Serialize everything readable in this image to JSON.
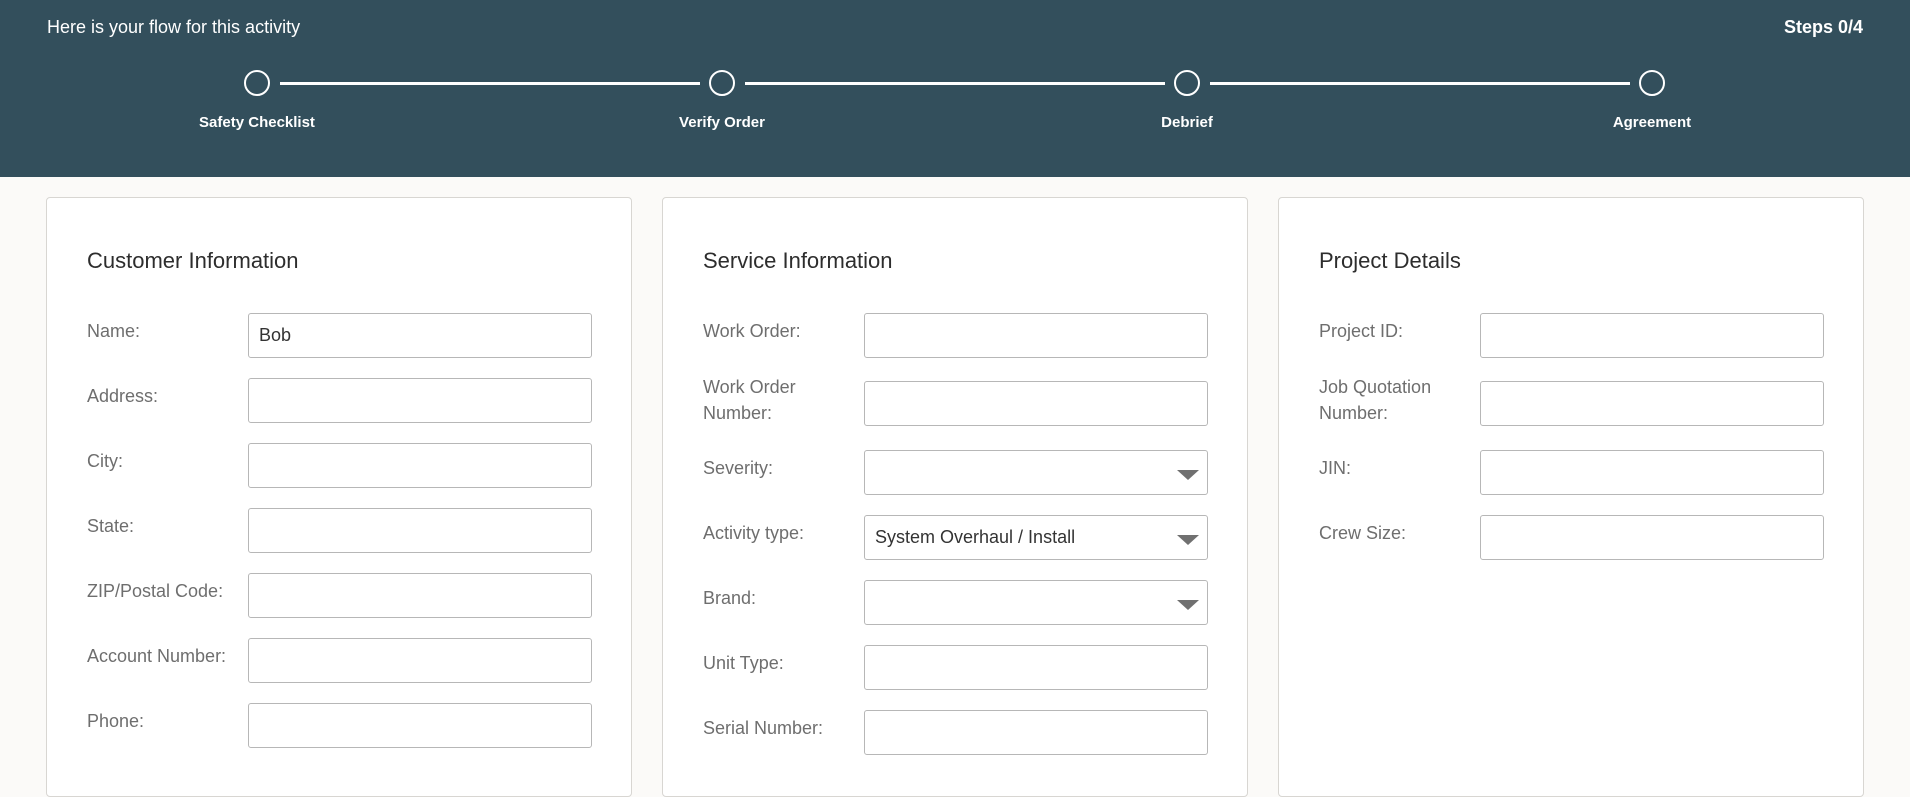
{
  "header": {
    "title": "Here is your flow for this activity",
    "steps_counter": "Steps 0/4",
    "steps": [
      {
        "label": "Safety Checklist"
      },
      {
        "label": "Verify Order"
      },
      {
        "label": "Debrief"
      },
      {
        "label": "Agreement"
      }
    ]
  },
  "customer": {
    "title": "Customer Information",
    "fields": {
      "name": {
        "label": "Name:",
        "value": "Bob"
      },
      "address": {
        "label": "Address:",
        "value": ""
      },
      "city": {
        "label": "City:",
        "value": ""
      },
      "state": {
        "label": "State:",
        "value": ""
      },
      "zip": {
        "label": "ZIP/Postal Code:",
        "value": ""
      },
      "account": {
        "label": "Account Number:",
        "value": ""
      },
      "phone": {
        "label": "Phone:",
        "value": ""
      }
    }
  },
  "service": {
    "title": "Service Information",
    "fields": {
      "work_order": {
        "label": "Work Order:",
        "value": ""
      },
      "work_order_number": {
        "label": "Work Order Number:",
        "value": ""
      },
      "severity": {
        "label": "Severity:",
        "value": ""
      },
      "activity_type": {
        "label": "Activity type:",
        "value": "System Overhaul / Install"
      },
      "brand": {
        "label": "Brand:",
        "value": ""
      },
      "unit_type": {
        "label": "Unit Type:",
        "value": ""
      },
      "serial_number": {
        "label": "Serial Number:",
        "value": ""
      }
    }
  },
  "project": {
    "title": "Project Details",
    "fields": {
      "project_id": {
        "label": "Project ID:",
        "value": ""
      },
      "job_quotation_number": {
        "label": "Job Quotation Number:",
        "value": ""
      },
      "jin": {
        "label": "JIN:",
        "value": ""
      },
      "crew_size": {
        "label": "Crew Size:",
        "value": ""
      }
    }
  },
  "colors": {
    "header_bg": "#334f5c",
    "page_bg": "#fbfaf8",
    "label_text": "#6e6e6e",
    "input_border": "#b7b7b7"
  },
  "icons": {
    "step_marker": "circle-outline-icon",
    "dropdown": "chevron-down-icon"
  }
}
